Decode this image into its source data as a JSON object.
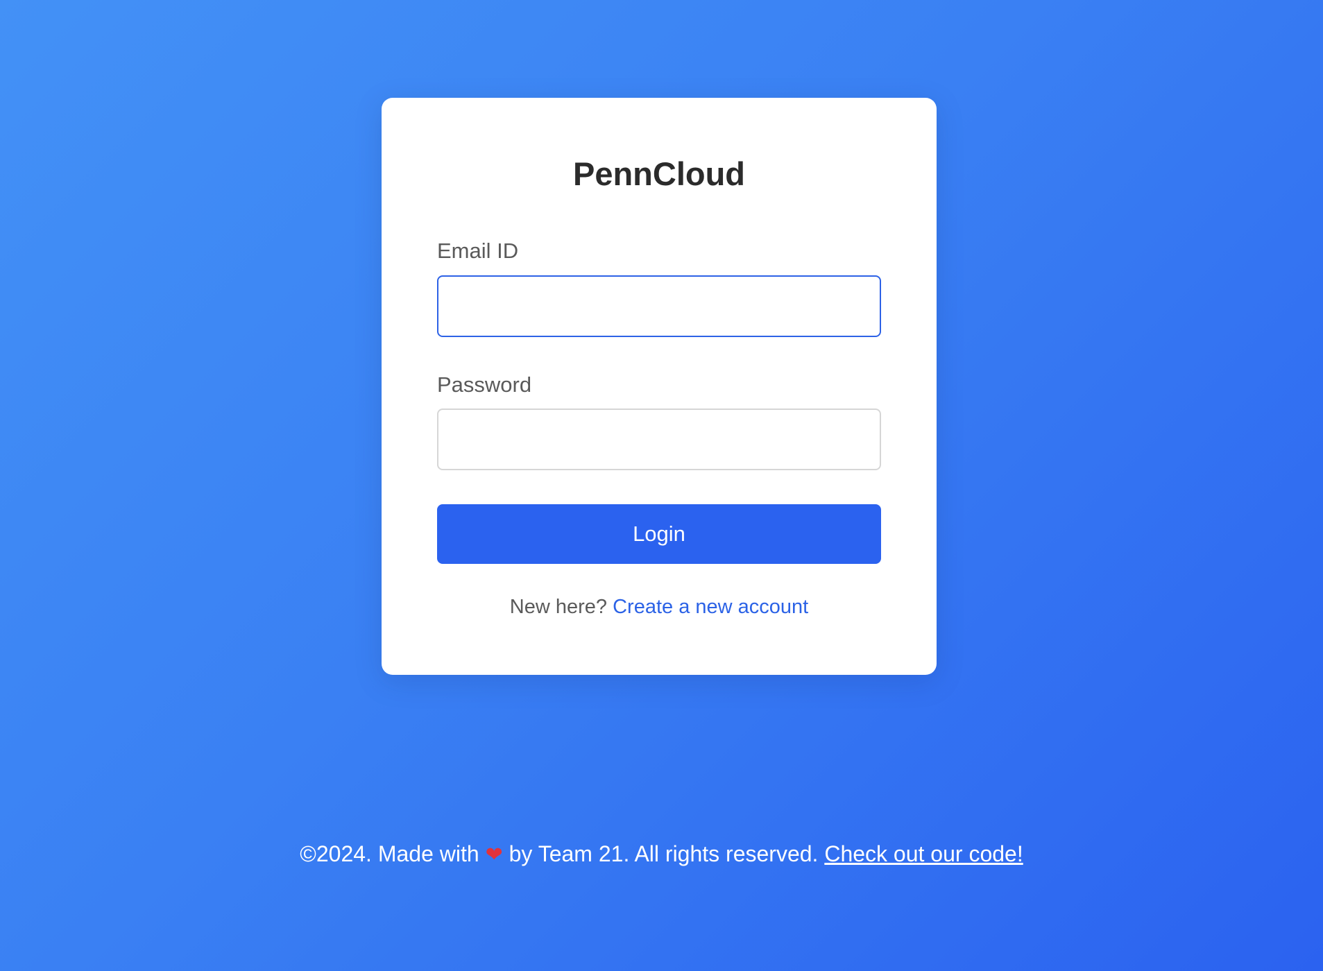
{
  "app": {
    "title": "PennCloud"
  },
  "form": {
    "email_label": "Email ID",
    "email_value": "",
    "password_label": "Password",
    "password_value": "",
    "login_label": "Login",
    "signup_prompt": "New here?",
    "signup_link": "Create a new account"
  },
  "footer": {
    "text_before": "©2024. Made with",
    "heart_icon": "heart-icon",
    "text_after": "by Team 21. All rights reserved.",
    "code_link": "Check out our code!"
  },
  "colors": {
    "background_start": "#4391f6",
    "background_end": "#2b62f0",
    "accent": "#2b62ef",
    "link": "#2b62e6",
    "heart": "#e3323b"
  }
}
